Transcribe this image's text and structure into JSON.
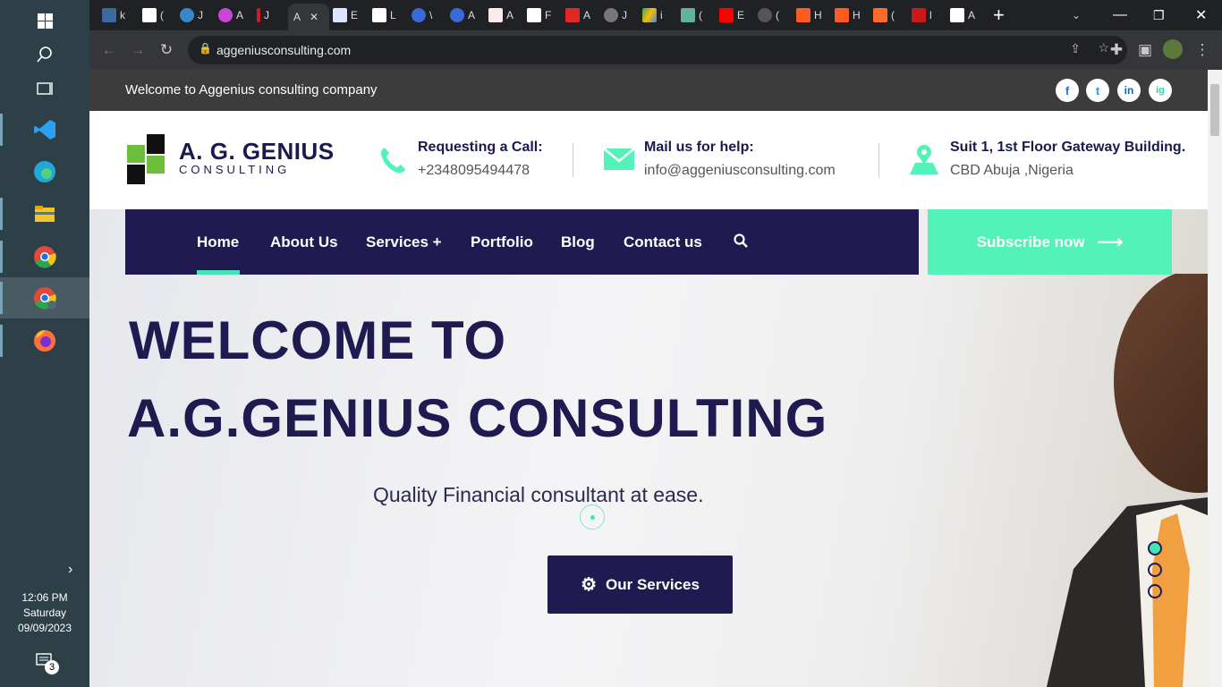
{
  "taskbar": {
    "time": "12:06 PM",
    "day": "Saturday",
    "date": "09/09/2023",
    "notification_count": "3"
  },
  "browser": {
    "tabs": [
      "k",
      "(",
      "J",
      "A",
      "J",
      "A",
      "E",
      "L",
      "\\",
      "A",
      "A",
      "F",
      "A",
      "J",
      "i",
      "(",
      "E",
      "(",
      "H",
      "H",
      "(",
      "l",
      "A"
    ],
    "active_tab_label": "A",
    "url": "aggeniusconsulting.com"
  },
  "site": {
    "topbar": {
      "welcome": "Welcome to Aggenius consulting company",
      "social": [
        "f",
        "t",
        "in",
        "ig"
      ]
    },
    "header": {
      "logo_name": "A. G. GENIUS",
      "logo_sub": "CONSULTING",
      "call": {
        "title": "Requesting a Call:",
        "value": "+2348095494478"
      },
      "mail": {
        "title": "Mail us for help:",
        "value": "info@aggeniusconsulting.com"
      },
      "address": {
        "title": "Suit 1, 1st Floor Gateway Building.",
        "value": "CBD Abuja ,Nigeria"
      }
    },
    "nav": {
      "items": [
        "Home",
        "About Us",
        "Services +",
        "Portfolio",
        "Blog",
        "Contact us"
      ],
      "subscribe": "Subscribe now"
    },
    "hero": {
      "line1": "WELCOME TO",
      "line2": "A.G.GENIUS CONSULTING",
      "subtitle": "Quality Financial consultant at ease.",
      "button": "Our Services",
      "slides_total": 3,
      "slide_active": 1
    },
    "colors": {
      "navy": "#1f1a4f",
      "accent": "#52f2b8",
      "green": "#6bbf3a"
    }
  }
}
